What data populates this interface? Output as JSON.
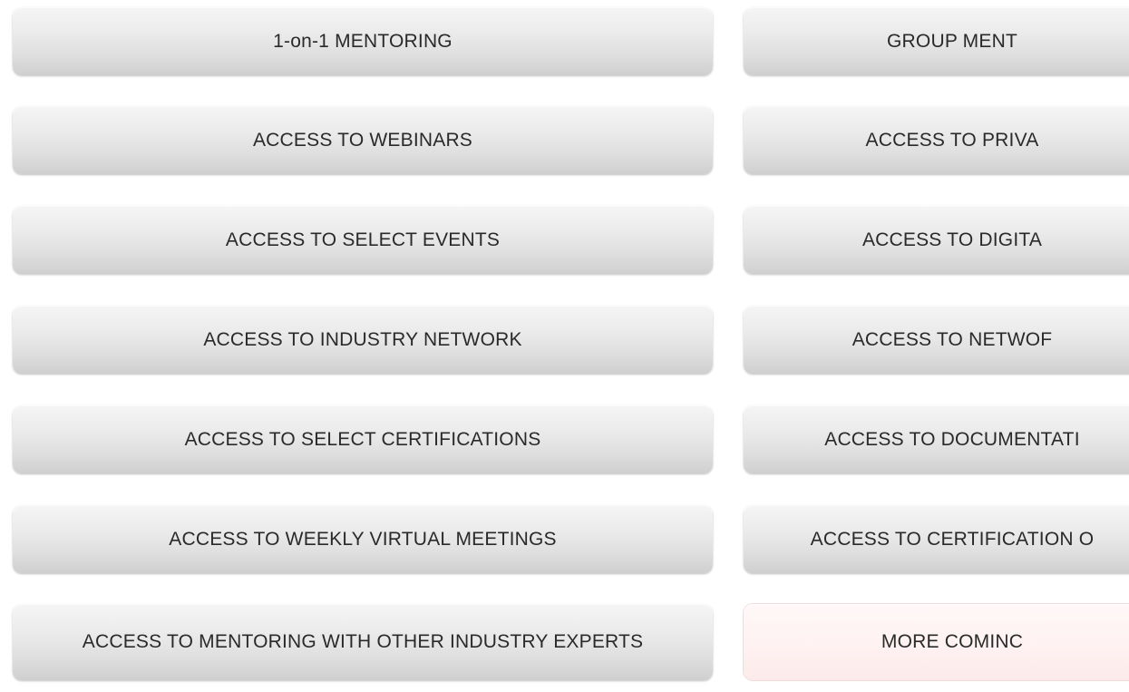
{
  "left_column": [
    "1-on-1 MENTORING",
    "ACCESS TO WEBINARS",
    "ACCESS TO SELECT EVENTS",
    "ACCESS TO INDUSTRY NETWORK",
    "ACCESS TO SELECT CERTIFICATIONS",
    "ACCESS TO WEEKLY VIRTUAL MEETINGS",
    "ACCESS TO MENTORING WITH OTHER INDUSTRY EXPERTS"
  ],
  "right_column": [
    "GROUP MENT",
    "ACCESS TO PRIVA",
    "ACCESS TO DIGITA",
    "ACCESS TO NETWOF",
    "ACCESS TO DOCUMENTATI",
    "ACCESS TO CERTIFICATION O",
    "MORE COMINC"
  ],
  "colors": {
    "button_text": "#2a2a2a",
    "coming_soon_bg": "#fff1f1"
  }
}
